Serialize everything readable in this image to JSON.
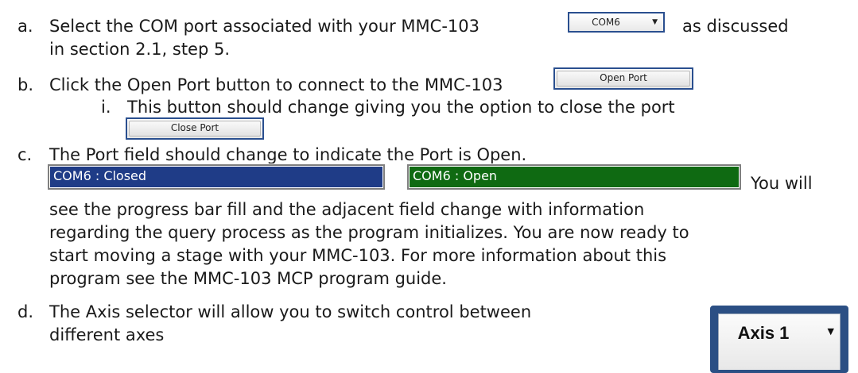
{
  "items": {
    "a": {
      "marker": "a.",
      "text_before": "Select the COM port associated with your MMC-103",
      "text_after": "as discussed",
      "line2": "in section 2.1, step 5.",
      "combo_value": "COM6"
    },
    "b": {
      "marker": "b.",
      "text": "Click the Open Port button to connect to the MMC-103",
      "button_label": "Open Port",
      "sub_marker": "i.",
      "sub_text": "This button should change giving you the option to close the port",
      "close_button_label": "Close Port"
    },
    "c": {
      "marker": "c.",
      "text": "The Port field should change to indicate the Port is Open.",
      "field_closed": "COM6 : Closed",
      "field_open": "COM6 : Open",
      "after_fields": "You will",
      "line3": "see the progress bar fill and the adjacent field change with information",
      "line4": "regarding the query process as the program initializes. You are now ready to",
      "line5": "start moving a stage with your MMC-103. For more information about this",
      "line6": "program see the MMC-103 MCP program guide."
    },
    "d": {
      "marker": "d.",
      "text": "The Axis selector will allow you to switch control between",
      "line2": "different axes",
      "axis_value": "Axis 1"
    }
  },
  "colors": {
    "closed_field": "#1f3c87",
    "open_field": "#0f6a12",
    "control_border": "#2a4f8f"
  }
}
